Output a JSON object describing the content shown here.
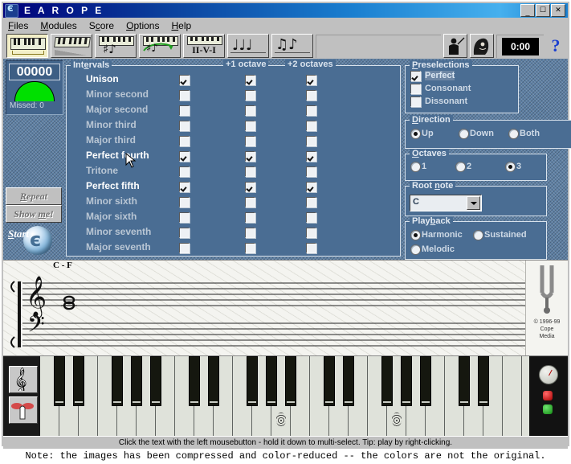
{
  "window": {
    "title": "E A R O P E",
    "icon": "earope-app-icon",
    "buttons": {
      "minimize": "_",
      "maximize": "□",
      "close": "✕"
    }
  },
  "menu": [
    {
      "label": "Files",
      "mnemonic": "F"
    },
    {
      "label": "Modules",
      "mnemonic": "M"
    },
    {
      "label": "Score",
      "mnemonic": "c"
    },
    {
      "label": "Options",
      "mnemonic": "O"
    },
    {
      "label": "Help",
      "mnemonic": "H"
    }
  ],
  "toolbar": {
    "buttons": [
      {
        "name": "intervals-module-button",
        "icon": "piano-keys-icon",
        "selected": true
      },
      {
        "name": "scales-module-button",
        "icon": "piano-stairs-icon",
        "selected": false
      },
      {
        "name": "chords-module-button",
        "icon": "piano-notes-icon",
        "selected": false
      },
      {
        "name": "chord-progressions-module-button",
        "icon": "piano-arrow-icon",
        "selected": false
      },
      {
        "name": "cadence-module-button",
        "icon": "II-V-I",
        "selected": false
      },
      {
        "name": "rhythm-module-button",
        "icon": "quarter-notes-icon",
        "selected": false
      },
      {
        "name": "rhythm-dictation-module-button",
        "icon": "beamed-notes-icon",
        "selected": false
      }
    ],
    "conductor_button": "conductor-icon",
    "composer_button": "composer-portrait-icon",
    "clock": "0:00",
    "help_button": "?"
  },
  "score_panel": {
    "score": "00000",
    "missed_label": "Missed: 0",
    "gauge_color": "#00e000",
    "repeat_label": "Repeat",
    "showme_label": "Show me!",
    "start_label": "Start"
  },
  "intervals": {
    "legend": "Intervals",
    "legend_mnemonic": "e",
    "columns": [
      "",
      "+1 octave",
      "+2 octaves"
    ],
    "rows": [
      {
        "label": "Unison",
        "selected": true,
        "checks": [
          true,
          true,
          true
        ]
      },
      {
        "label": "Minor second",
        "selected": false,
        "checks": [
          false,
          false,
          false
        ]
      },
      {
        "label": "Major second",
        "selected": false,
        "checks": [
          false,
          false,
          false
        ]
      },
      {
        "label": "Minor third",
        "selected": false,
        "checks": [
          false,
          false,
          false
        ]
      },
      {
        "label": "Major third",
        "selected": false,
        "checks": [
          false,
          false,
          false
        ]
      },
      {
        "label": "Perfect fourth",
        "selected": true,
        "checks": [
          true,
          true,
          true
        ]
      },
      {
        "label": "Tritone",
        "selected": false,
        "checks": [
          false,
          false,
          false
        ]
      },
      {
        "label": "Perfect fifth",
        "selected": true,
        "checks": [
          true,
          true,
          true
        ]
      },
      {
        "label": "Minor sixth",
        "selected": false,
        "checks": [
          false,
          false,
          false
        ]
      },
      {
        "label": "Major sixth",
        "selected": false,
        "checks": [
          false,
          false,
          false
        ]
      },
      {
        "label": "Minor seventh",
        "selected": false,
        "checks": [
          false,
          false,
          false
        ]
      },
      {
        "label": "Major seventh",
        "selected": false,
        "checks": [
          false,
          false,
          false
        ]
      }
    ]
  },
  "preselections": {
    "legend": "Preselections",
    "legend_mnemonic": "P",
    "options": [
      {
        "label": "Perfect",
        "checked": true,
        "highlighted": true
      },
      {
        "label": "Consonant",
        "checked": false,
        "highlighted": false
      },
      {
        "label": "Dissonant",
        "checked": false,
        "highlighted": false
      }
    ]
  },
  "direction": {
    "legend": "Direction",
    "legend_mnemonic": "D",
    "options": [
      {
        "label": "Up",
        "selected": true
      },
      {
        "label": "Down",
        "selected": false
      },
      {
        "label": "Both",
        "selected": false
      }
    ]
  },
  "octaves": {
    "legend": "Octaves",
    "legend_mnemonic": "O",
    "options": [
      {
        "label": "1",
        "selected": false
      },
      {
        "label": "2",
        "selected": false
      },
      {
        "label": "3",
        "selected": true
      }
    ]
  },
  "root_note": {
    "legend": "Root note",
    "legend_mnemonic": "n",
    "value": "C"
  },
  "playback": {
    "legend": "Playback",
    "legend_mnemonic": "b",
    "options": [
      {
        "label": "Harmonic",
        "selected": true
      },
      {
        "label": "Sustained",
        "selected": false
      },
      {
        "label": "Melodic",
        "selected": false
      }
    ]
  },
  "staff": {
    "chord_label": "C - F",
    "treble_clef": "treble-clef-icon",
    "bass_clef": "bass-clef-icon",
    "notes": [
      "C",
      "F"
    ],
    "tuning_fork": "tuning-fork-icon",
    "copyright_lines": [
      "© 1996-99",
      "Cope",
      "Media"
    ]
  },
  "keyboard": {
    "side_buttons": [
      {
        "name": "treble-clef-toggle-button",
        "icon": "clef-icon"
      },
      {
        "name": "play-hand-button",
        "icon": "hand-pointer-icon"
      }
    ],
    "marked_keys": [
      2,
      2
    ],
    "knob": "volume-knob",
    "leds": [
      "#a80000",
      "#128a12"
    ]
  },
  "status_bar": {
    "text": "Click the text with the left mousebutton - hold it down to multi-select. Tip: play by right-clicking."
  },
  "footnote": {
    "text": "Note: the images has been compressed and color-reduced -- the colors are not the original."
  }
}
